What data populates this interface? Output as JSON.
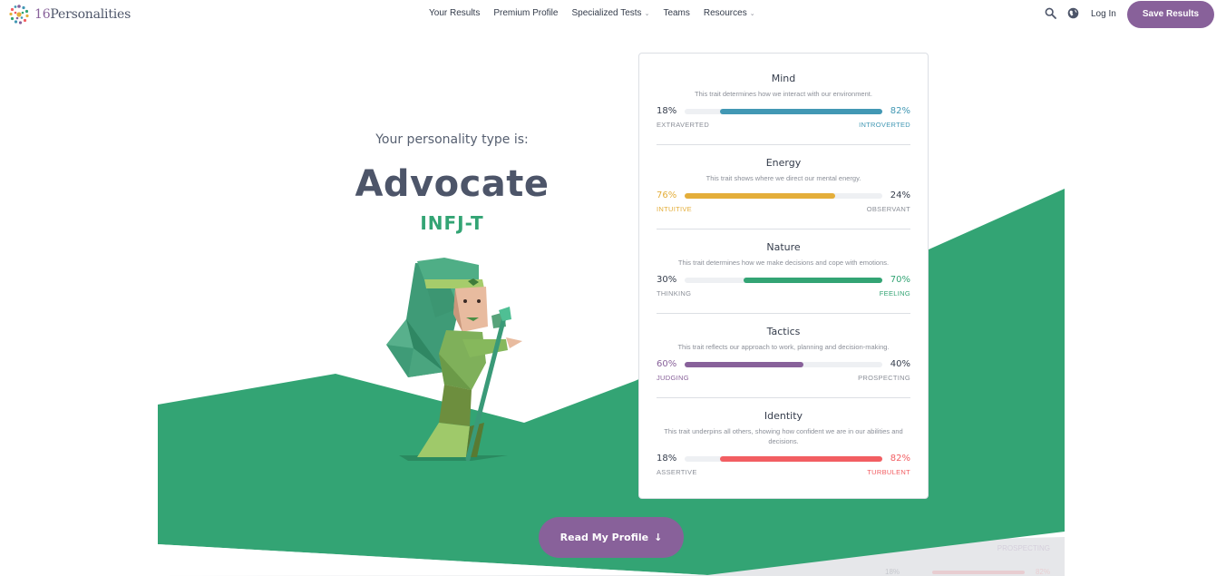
{
  "header": {
    "logo": {
      "num": "16",
      "word": "Personalities"
    },
    "nav": [
      {
        "label": "Your Results",
        "has_dropdown": false
      },
      {
        "label": "Premium Profile",
        "has_dropdown": false
      },
      {
        "label": "Specialized Tests",
        "has_dropdown": true
      },
      {
        "label": "Teams",
        "has_dropdown": false
      },
      {
        "label": "Resources",
        "has_dropdown": true
      }
    ],
    "search_icon": "search-icon",
    "language_icon": "globe-icon",
    "login_label": "Log In",
    "save_label": "Save Results"
  },
  "hero": {
    "intro": "Your personality type is:",
    "type_name": "Advocate",
    "type_code": "INFJ-T"
  },
  "traits": [
    {
      "title": "Mind",
      "description": "This trait determines how we interact with our environment.",
      "left_pct": "18%",
      "right_pct": "82%",
      "left_label": "EXTRAVERTED",
      "right_label": "INTROVERTED",
      "dominant": "right",
      "fill_fraction": 0.82,
      "color": "#4298b4"
    },
    {
      "title": "Energy",
      "description": "This trait shows where we direct our mental energy.",
      "left_pct": "76%",
      "right_pct": "24%",
      "left_label": "INTUITIVE",
      "right_label": "OBSERVANT",
      "dominant": "left",
      "fill_fraction": 0.76,
      "color": "#e4ae3a"
    },
    {
      "title": "Nature",
      "description": "This trait determines how we make decisions and cope with emotions.",
      "left_pct": "30%",
      "right_pct": "70%",
      "left_label": "THINKING",
      "right_label": "FEELING",
      "dominant": "right",
      "fill_fraction": 0.7,
      "color": "#33a474"
    },
    {
      "title": "Tactics",
      "description": "This trait reflects our approach to work, planning and decision-making.",
      "left_pct": "60%",
      "right_pct": "40%",
      "left_label": "JUDGING",
      "right_label": "PROSPECTING",
      "dominant": "left",
      "fill_fraction": 0.6,
      "color": "#88619a"
    },
    {
      "title": "Identity",
      "description": "This trait underpins all others, showing how confident we are in our abilities and decisions.",
      "left_pct": "18%",
      "right_pct": "82%",
      "left_label": "ASSERTIVE",
      "right_label": "TURBULENT",
      "dominant": "right",
      "fill_fraction": 0.82,
      "color": "#f25e62"
    }
  ],
  "cta_label": "Read My Profile",
  "cta_icon": "arrow-down-icon",
  "ghost": {
    "label": "PROSPECTING",
    "left_pct": "18%",
    "right_pct": "82%"
  },
  "colors": {
    "brand": "#88619a",
    "green": "#33a474",
    "text": "#343c4b",
    "muted": "#8b8f98"
  }
}
